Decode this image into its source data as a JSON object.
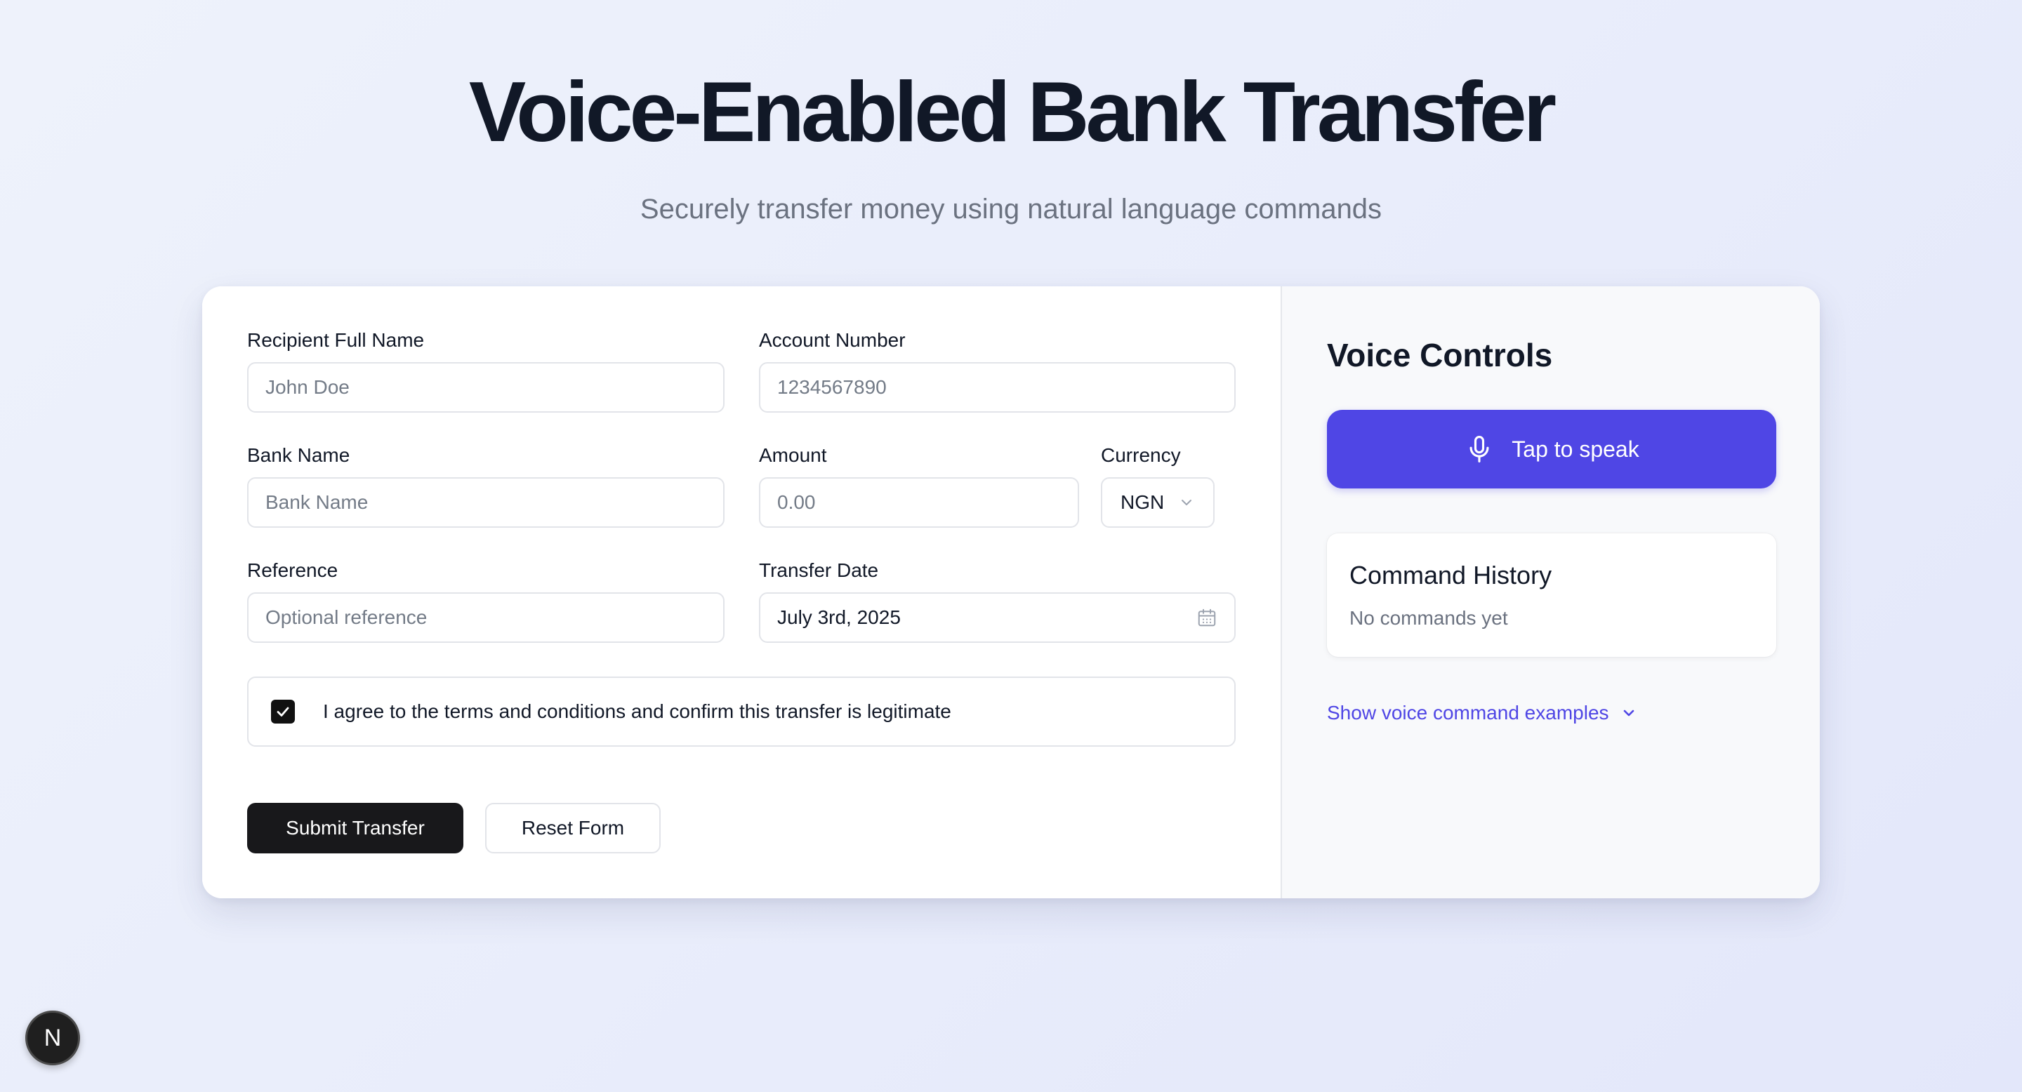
{
  "header": {
    "title": "Voice-Enabled Bank Transfer",
    "subtitle": "Securely transfer money using natural language commands"
  },
  "form": {
    "recipient": {
      "label": "Recipient Full Name",
      "placeholder": "John Doe",
      "value": ""
    },
    "account": {
      "label": "Account Number",
      "placeholder": "1234567890",
      "value": ""
    },
    "bank": {
      "label": "Bank Name",
      "placeholder": "Bank Name",
      "value": ""
    },
    "amount": {
      "label": "Amount",
      "placeholder": "0.00",
      "value": ""
    },
    "currency": {
      "label": "Currency",
      "value": "NGN"
    },
    "reference": {
      "label": "Reference",
      "placeholder": "Optional reference",
      "value": ""
    },
    "date": {
      "label": "Transfer Date",
      "value": "July 3rd, 2025"
    },
    "agree": {
      "label": "I agree to the terms and conditions and confirm this transfer is legitimate",
      "checked": true
    },
    "submit_label": "Submit Transfer",
    "reset_label": "Reset Form"
  },
  "voice": {
    "title": "Voice Controls",
    "speak_label": "Tap to speak",
    "history_title": "Command History",
    "history_empty": "No commands yet",
    "examples_label": "Show voice command examples"
  },
  "badge": {
    "letter": "N"
  },
  "icons": {
    "mic": "microphone-icon",
    "calendar": "calendar-icon",
    "chevron": "chevron-down-icon",
    "check": "check-icon"
  },
  "colors": {
    "accent": "#4f46e5",
    "primary_button": "#18181b",
    "title": "#111827",
    "muted": "#6b7280"
  }
}
